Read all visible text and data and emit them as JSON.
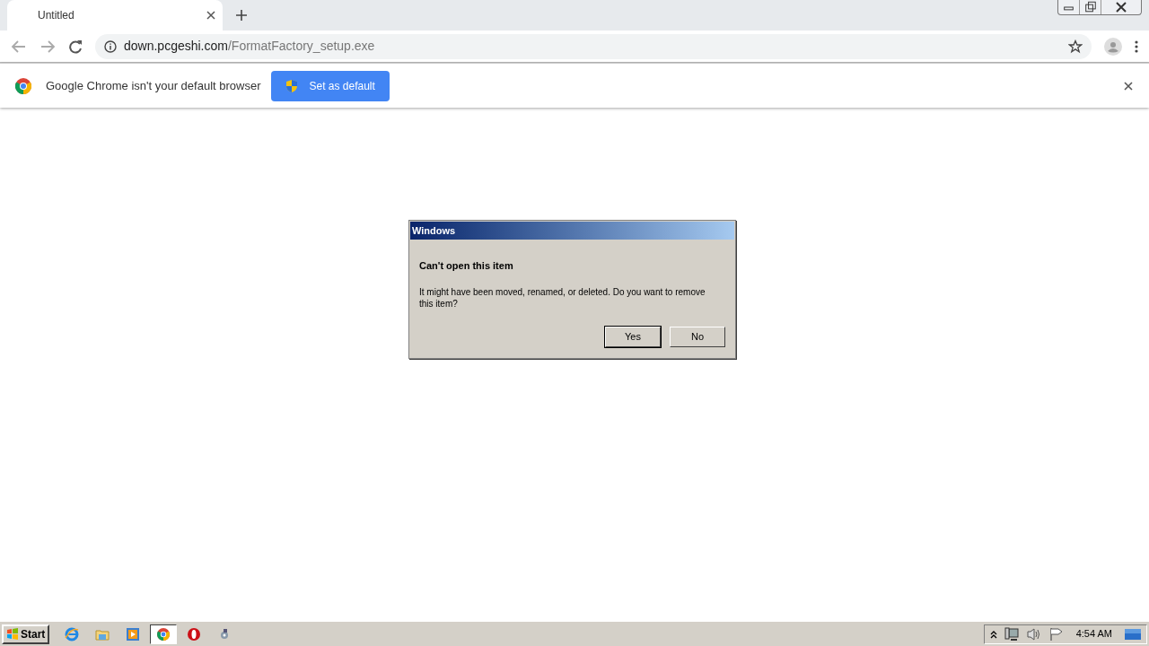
{
  "browser": {
    "tab": {
      "title": "Untitled"
    },
    "address": {
      "host": "down.pcgeshi.com",
      "path": "/FormatFactory_setup.exe"
    }
  },
  "infobar": {
    "message": "Google Chrome isn't your default browser",
    "button": "Set as default"
  },
  "dialog": {
    "title": "Windows",
    "heading": "Can't open this item",
    "message": "It might have been moved, renamed, or deleted. Do you want to remove this item?",
    "buttons": [
      {
        "label": "Yes",
        "selected": true
      },
      {
        "label": "No",
        "selected": false
      }
    ]
  },
  "taskbar": {
    "start": "Start",
    "items": [
      {
        "kind": "ie",
        "selected": false
      },
      {
        "kind": "folder",
        "selected": false
      },
      {
        "kind": "media",
        "selected": false
      },
      {
        "kind": "chrome",
        "selected": true
      },
      {
        "kind": "opera",
        "selected": false
      },
      {
        "kind": "tool",
        "selected": false
      }
    ],
    "clock": "4:54 AM"
  }
}
